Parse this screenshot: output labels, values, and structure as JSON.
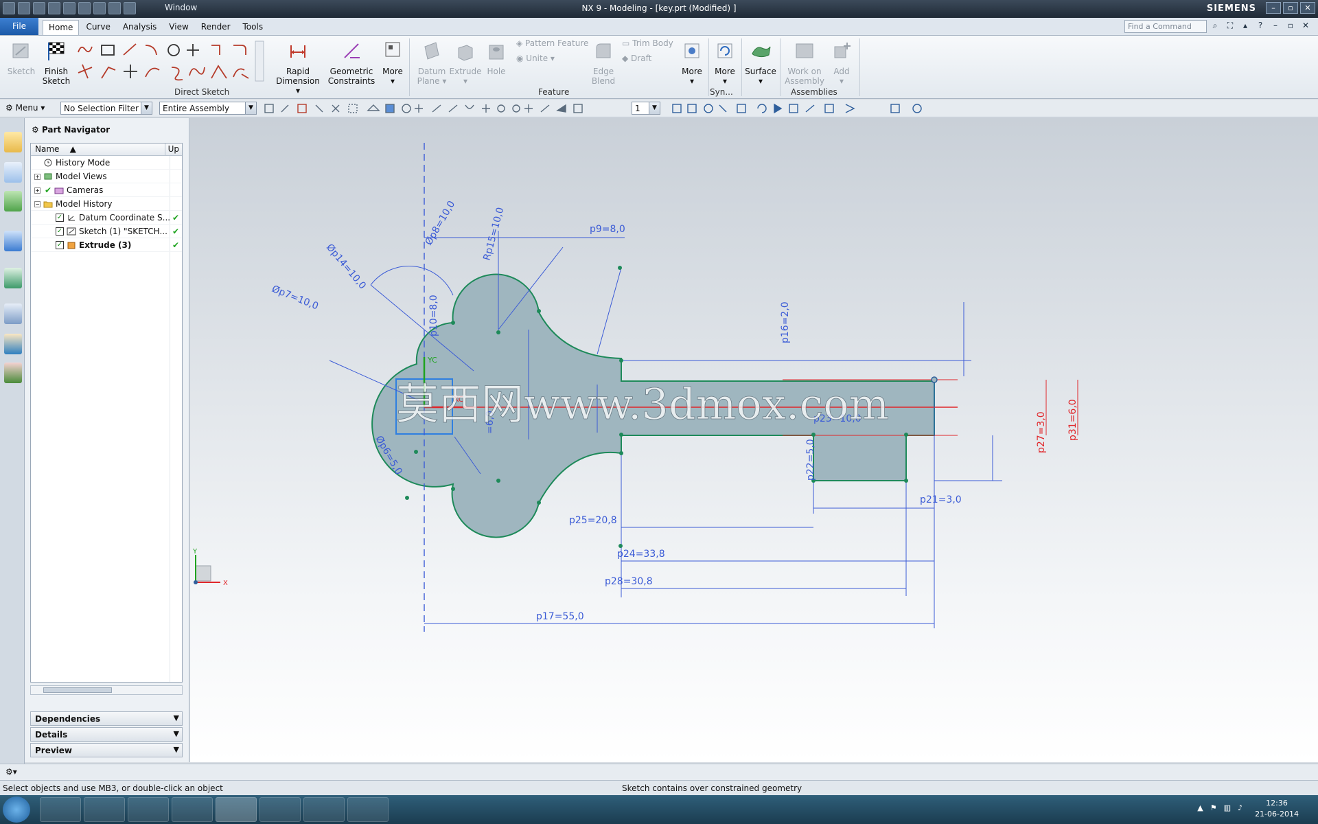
{
  "window": {
    "title": "NX 9 - Modeling - [key.prt (Modified) ]",
    "brand": "SIEMENS",
    "window_menu": "Window",
    "buttons": [
      "minimize",
      "restore",
      "close"
    ]
  },
  "menubar": {
    "file": "File",
    "tabs": [
      "Home",
      "Curve",
      "Analysis",
      "View",
      "Render",
      "Tools"
    ],
    "active_tab": "Home",
    "find_command_placeholder": "Find a Command"
  },
  "ribbon": {
    "sketch": "Sketch",
    "finish_sketch": [
      "Finish",
      "Sketch"
    ],
    "rapid_dimension": [
      "Rapid",
      "Dimension"
    ],
    "geometric_constraints": [
      "Geometric",
      "Constraints"
    ],
    "more": "More",
    "datum_plane": [
      "Datum",
      "Plane"
    ],
    "extrude": "Extrude",
    "hole": "Hole",
    "pattern_feature": "Pattern Feature",
    "unite": "Unite",
    "edge_blend": [
      "Edge",
      "Blend"
    ],
    "trim_body": "Trim Body",
    "draft": "Draft",
    "more2": "More",
    "more3": "More",
    "surface": "Surface",
    "work_on_assembly": [
      "Work on",
      "Assembly"
    ],
    "add": "Add",
    "groups": {
      "direct_sketch": "Direct Sketch",
      "feature": "Feature",
      "syn": "Syn...",
      "assemblies": "Assemblies"
    }
  },
  "selection_bar": {
    "menu": "Menu",
    "filter": "No Selection Filter",
    "scope": "Entire Assembly",
    "layer": "1"
  },
  "navigator": {
    "title": "Part Navigator",
    "columns": [
      "Name",
      "Up"
    ],
    "items": [
      {
        "label": "History Mode",
        "level": 0
      },
      {
        "label": "Model Views",
        "level": 0
      },
      {
        "label": "Cameras",
        "level": 0
      },
      {
        "label": "Model History",
        "level": 0
      },
      {
        "label": "Datum Coordinate S...",
        "level": 1
      },
      {
        "label": "Sketch (1) \"SKETCH...",
        "level": 1
      },
      {
        "label": "Extrude (3)",
        "level": 1
      }
    ],
    "panels": [
      "Dependencies",
      "Details",
      "Preview"
    ]
  },
  "sketch": {
    "dimensions": {
      "p9": "p9=8,0",
      "p8": "Øp8=10,0",
      "p15": "Rp15=10,0",
      "p14": "Øp14=10,0",
      "p7": "Øp7=10,0",
      "p10": "p10=8,0",
      "p6": "Øp6=5,0",
      "p16": "p16=2,0",
      "p27": "p27=3,0",
      "p31": "p31=6,0",
      "p22": "p22=5,0",
      "p23": "p23=10,0",
      "p21": "p21=3,0",
      "p25": "p25=20,8",
      "p24": "p24=33,8",
      "p28": "p28=30,8",
      "p17": "p17=55,0",
      "small_vertical": "=6,0"
    },
    "axis_labels": {
      "yc": "YC",
      "xc": "XC",
      "triad_x": "X",
      "triad_y": "Y"
    },
    "watermark": "莫西网www.3dmox.com"
  },
  "status": {
    "cue": "Select objects and use MB3, or double-click an object",
    "status": "Sketch contains over constrained geometry"
  },
  "taskbar": {
    "time": "12:36",
    "date": "21-06-2014"
  },
  "colors": {
    "sketch_fill": "#9db6c0",
    "sketch_edge": "#1e8a5a",
    "dimension": "#3b5bd6",
    "over_constrained": "#e0262a"
  }
}
